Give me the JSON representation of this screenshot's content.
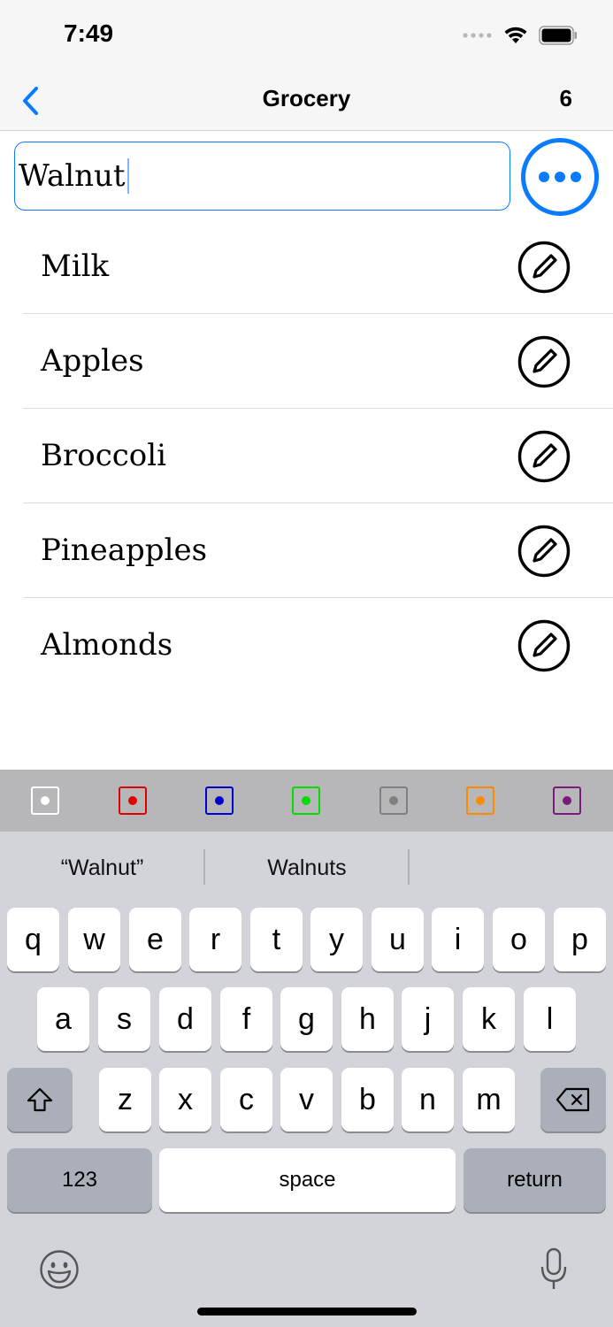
{
  "status_bar": {
    "time": "7:49"
  },
  "nav": {
    "title": "Grocery",
    "count": "6"
  },
  "input": {
    "value": "Walnut"
  },
  "list": {
    "items": [
      {
        "label": "Milk"
      },
      {
        "label": "Apples"
      },
      {
        "label": "Broccoli"
      },
      {
        "label": "Pineapples"
      },
      {
        "label": "Almonds"
      }
    ]
  },
  "colors": {
    "accent": "#0a7aff",
    "swatches": [
      "#ffffff",
      "#e00000",
      "#0000cc",
      "#00dd00",
      "#808080",
      "#ff8a00",
      "#7a1a7a"
    ]
  },
  "keyboard": {
    "suggestions": [
      "“Walnut”",
      "Walnuts",
      ""
    ],
    "row1": [
      "q",
      "w",
      "e",
      "r",
      "t",
      "y",
      "u",
      "i",
      "o",
      "p"
    ],
    "row2": [
      "a",
      "s",
      "d",
      "f",
      "g",
      "h",
      "j",
      "k",
      "l"
    ],
    "row3": [
      "z",
      "x",
      "c",
      "v",
      "b",
      "n",
      "m"
    ],
    "numbers_label": "123",
    "space_label": "space",
    "return_label": "return"
  }
}
